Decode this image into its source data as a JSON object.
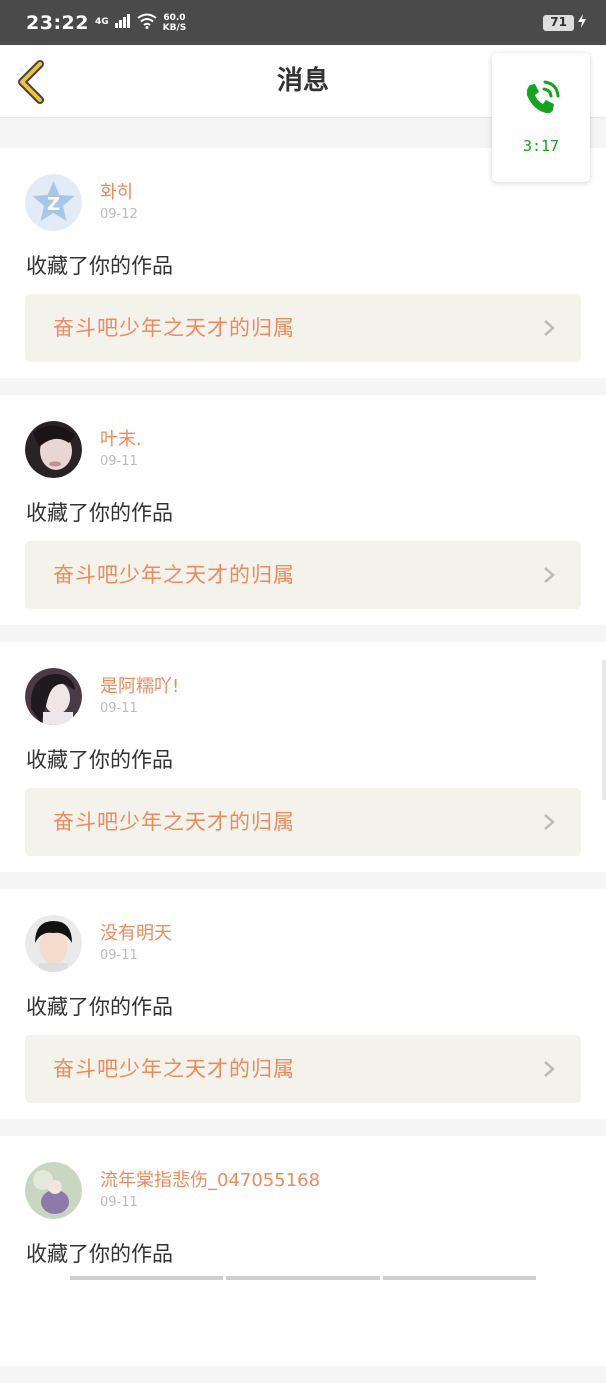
{
  "status_bar": {
    "time": "23:22",
    "network": "4G",
    "speed_value": "60.0",
    "speed_unit": "KB/S",
    "battery": "71"
  },
  "header": {
    "title": "消息"
  },
  "call_widget": {
    "duration": "3:17",
    "color": "#12a51e"
  },
  "messages": [
    {
      "user": "화히",
      "date": "09-12",
      "action": "收藏了你的作品",
      "work_title": "奋斗吧少年之天才的归属",
      "avatar": "qq-default-avatar"
    },
    {
      "user": "叶末.",
      "date": "09-11",
      "action": "收藏了你的作品",
      "work_title": "奋斗吧少年之天才的归属",
      "avatar": "user-photo-avatar"
    },
    {
      "user": "是阿糯吖!",
      "date": "09-11",
      "action": "收藏了你的作品",
      "work_title": "奋斗吧少年之天才的归属",
      "avatar": "user-photo-avatar"
    },
    {
      "user": "没有明天",
      "date": "09-11",
      "action": "收藏了你的作品",
      "work_title": "奋斗吧少年之天才的归属",
      "avatar": "user-photo-avatar"
    },
    {
      "user": "流年棠指悲伤_047055168",
      "date": "09-11",
      "action": "收藏了你的作品",
      "work_title": "",
      "avatar": "user-photo-avatar"
    }
  ],
  "colors": {
    "accent": "#f08a5d",
    "work_bg": "#f3f3ec",
    "back_arrow": "#f2c232"
  }
}
